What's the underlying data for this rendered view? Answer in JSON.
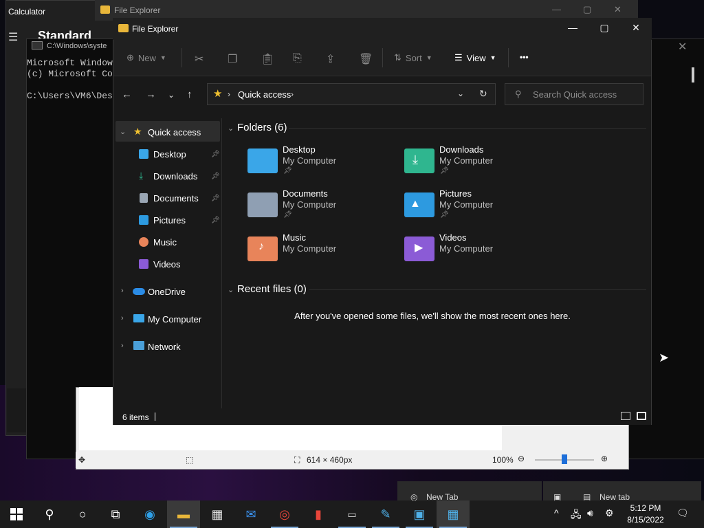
{
  "calculator": {
    "title": "Calculator",
    "mode": "Standard",
    "key_plusminus": "+/-",
    "menu_icon": "☰"
  },
  "explorer_back": {
    "title": "File Explorer"
  },
  "cmd": {
    "title": "C:\\Windows\\syste",
    "lines": "Microsoft Window\n(c) Microsoft Co\n\nC:\\Users\\VM6\\Des"
  },
  "paint": {
    "size": "614 × 460px",
    "zoom": "100%"
  },
  "chrome": {
    "tab1": "New Tab",
    "tab2": "New tab"
  },
  "explorer": {
    "title": "File Explorer",
    "toolbar": {
      "new": "New",
      "sort": "Sort",
      "view": "View",
      "more": "•••"
    },
    "address": {
      "location": "Quick access"
    },
    "search": {
      "placeholder": "Search Quick access"
    },
    "sidebar": {
      "quick_access": "Quick access",
      "items": [
        {
          "label": "Desktop"
        },
        {
          "label": "Downloads"
        },
        {
          "label": "Documents"
        },
        {
          "label": "Pictures"
        },
        {
          "label": "Music"
        },
        {
          "label": "Videos"
        }
      ],
      "onedrive": "OneDrive",
      "my_computer": "My Computer",
      "network": "Network"
    },
    "folders_header": "Folders (6)",
    "folders": [
      {
        "name": "Desktop",
        "location": "My Computer",
        "color": "#3aa6e8"
      },
      {
        "name": "Downloads",
        "location": "My Computer",
        "color": "#2fb68f"
      },
      {
        "name": "Documents",
        "location": "My Computer",
        "color": "#8f9fb3"
      },
      {
        "name": "Pictures",
        "location": "My Computer",
        "color": "#2d9ae0"
      },
      {
        "name": "Music",
        "location": "My Computer",
        "color": "#e8845a"
      },
      {
        "name": "Videos",
        "location": "My Computer",
        "color": "#8b5bd6"
      }
    ],
    "recent_header": "Recent files (0)",
    "recent_empty": "After you've opened some files, we'll show the most recent ones here.",
    "status": "6 items"
  },
  "taskbar": {
    "time": "5:12 PM",
    "date": "8/15/2022"
  }
}
